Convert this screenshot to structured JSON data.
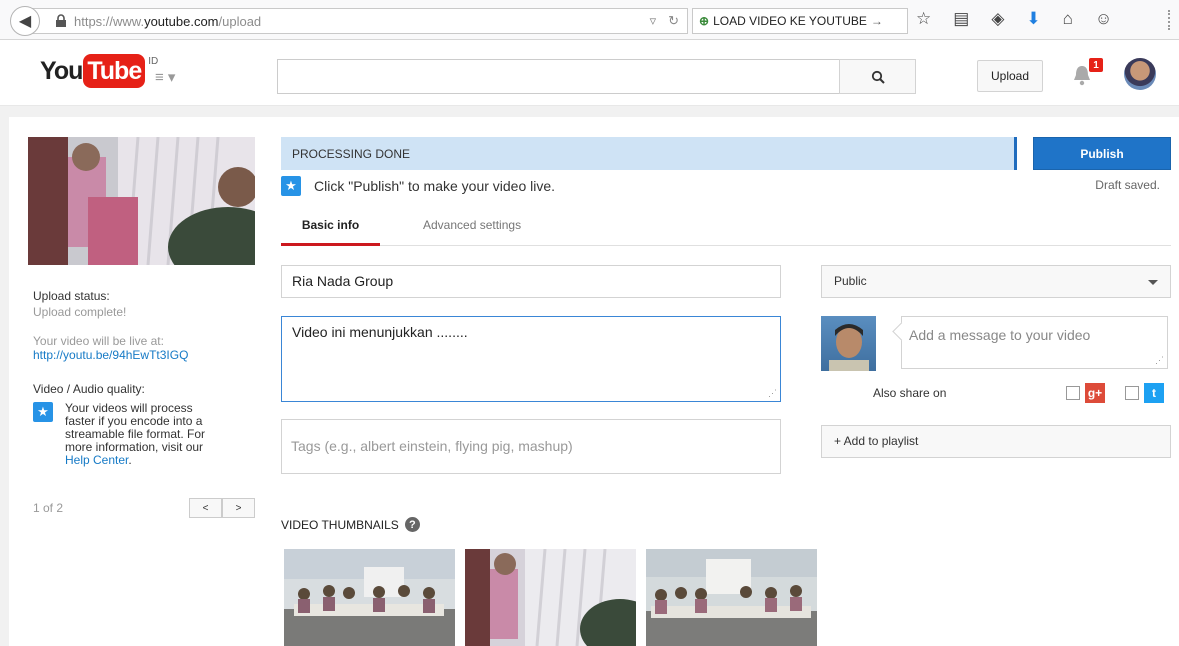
{
  "browser": {
    "url_prefix": "https://www.",
    "url_host": "youtube.com",
    "url_path": "/upload",
    "search_text": "LOAD VIDEO KE YOUTUBE"
  },
  "header": {
    "logo_you": "You",
    "logo_tube": "Tube",
    "logo_region": "ID",
    "search_placeholder": "",
    "upload_label": "Upload",
    "notification_count": "1"
  },
  "left": {
    "upload_status_label": "Upload status:",
    "upload_status_value": "Upload complete!",
    "live_at_label": "Your video will be live at:",
    "video_link": "http://youtu.be/94hEwTt3IGQ",
    "quality_label": "Video / Audio quality:",
    "quality_note": "Your videos will process faster if you encode into a streamable file format. For more information, visit our",
    "help_link": "Help Center",
    "help_suffix": ".",
    "pager_text": "1 of 2"
  },
  "status": {
    "processing": "PROCESSING DONE",
    "publish_label": "Publish",
    "draft_saved": "Draft saved.",
    "hint": "Click \"Publish\" to make your video live."
  },
  "tabs": [
    {
      "label": "Basic info",
      "active": true
    },
    {
      "label": "Advanced settings",
      "active": false
    }
  ],
  "form": {
    "title_value": "Ria Nada Group",
    "description_value": "Video ini menunjukkan ........",
    "tags_placeholder": "Tags (e.g., albert einstein, flying pig, mashup)"
  },
  "sidebar_right": {
    "privacy_value": "Public",
    "share_message_placeholder": "Add a message to your video",
    "also_share_label": "Also share on",
    "gplus_glyph": "g+",
    "twitter_glyph": "t",
    "playlist_label": "+ Add to playlist"
  },
  "thumbnails": {
    "title": "VIDEO THUMBNAILS",
    "help_glyph": "?"
  },
  "colors": {
    "brand_red": "#e62117",
    "publish_blue": "#1f74c8",
    "processing_bg": "#cfe3f5",
    "link_blue": "#167ac6"
  }
}
